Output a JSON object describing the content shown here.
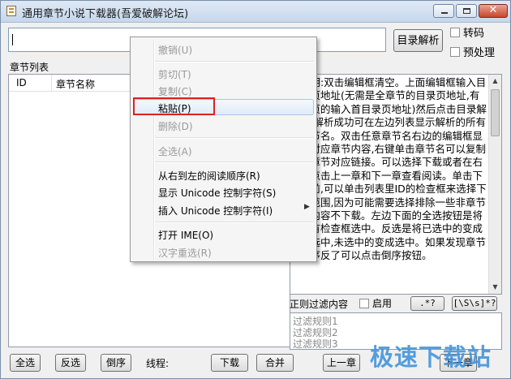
{
  "window": {
    "title": "通用章节小说下载器(吾爱破解论坛)"
  },
  "url_input": {
    "value": ""
  },
  "buttons": {
    "parse_catalog": "目录解析",
    "select_all": "全选",
    "invert_select": "反选",
    "reverse_order": "倒序",
    "download": "下载",
    "merge": "合并",
    "prev_chapter": "上一章",
    "next_chapter": "下一章",
    "regex_any": ".*?",
    "regex_space": "[\\S\\s]*?"
  },
  "options": {
    "transcode": "转码",
    "preprocess": "预处理",
    "enable": "启用"
  },
  "labels": {
    "chapter_list": "章节列表",
    "threads": "线程:",
    "regex_filter": "正则过滤内容"
  },
  "chapter_table": {
    "columns": [
      "ID",
      "章节名称"
    ]
  },
  "help_text": "说明:双击编辑框清空。上面编辑框输入目录页地址(无需是全章节的目录页地址,有翻页的输入首目录页地址)然后点击目录解析,解析成功可在左边列表显示解析的所有章节名。双击任意章节名右边的编辑框显示对应章节内容,右键单击章节名可以复制该章节对应链接。可以选择下载或者在右边点击上一章和下一章查看阅读。单击下载前,可以单击列表里ID的检查框来选择下载范围,因为可能需要选择排除一些非章节的内容不下载。左边下面的全选按钮是将所有检查框选中。反选是将已选中的变成未选中,未选中的变成选中。如果发现章节顺序反了可以点击倒序按钮。",
  "filter_rules": [
    "过滤规则1",
    "过滤规则2",
    "过滤规则3"
  ],
  "context_menu": {
    "items": [
      {
        "label": "撤销(U)",
        "enabled": false
      },
      {
        "label": "剪切(T)",
        "enabled": false
      },
      {
        "label": "复制(C)",
        "enabled": false
      },
      {
        "label": "粘贴(P)",
        "enabled": true,
        "highlighted": true
      },
      {
        "label": "删除(D)",
        "enabled": false
      },
      {
        "label": "全选(A)",
        "enabled": false
      },
      {
        "label": "从右到左的阅读顺序(R)",
        "enabled": true
      },
      {
        "label": "显示 Unicode 控制字符(S)",
        "enabled": true
      },
      {
        "label": "插入 Unicode 控制字符(I)",
        "enabled": true,
        "has_submenu": true
      },
      {
        "label": "打开 IME(O)",
        "enabled": true
      },
      {
        "label": "汉字重选(R)",
        "enabled": false
      }
    ]
  },
  "watermark": "极速下载站",
  "colors": {
    "accent_highlight": "#a9c7ec",
    "annotation_red": "#e02020",
    "watermark_blue": "#3a8fd9"
  }
}
